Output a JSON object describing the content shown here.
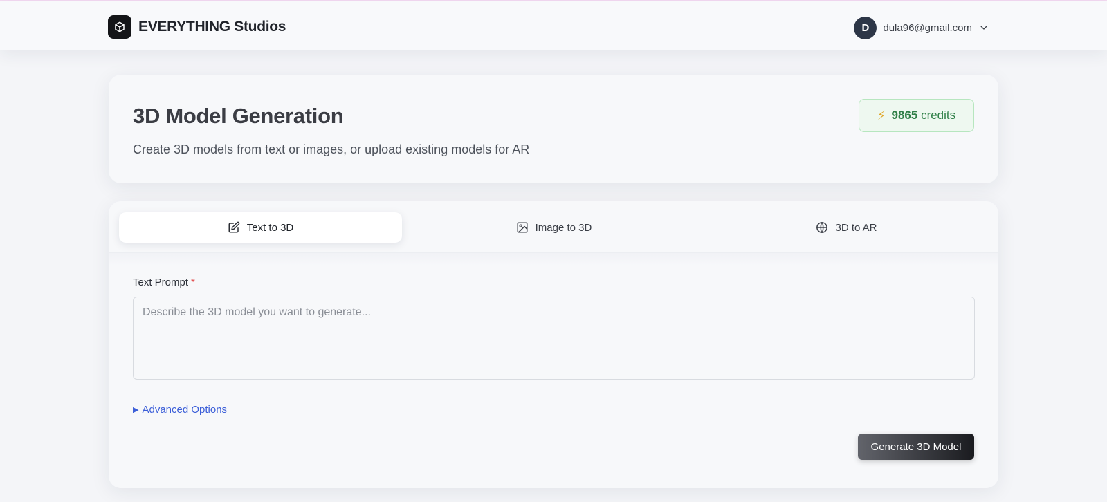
{
  "header": {
    "brand_name": "EVERYTHING Studios",
    "logo_icon": "cube-icon",
    "user": {
      "avatar_initial": "D",
      "email": "dula96@gmail.com",
      "menu_icon": "chevron-down-icon"
    }
  },
  "overview": {
    "title": "3D Model Generation",
    "subtitle": "Create 3D models from text or images, or upload existing models for AR",
    "credits": {
      "icon": "lightning-icon",
      "value": "9865",
      "unit": "credits"
    }
  },
  "tabs": [
    {
      "label": "Text to 3D",
      "icon": "edit-icon",
      "active": true
    },
    {
      "label": "Image to 3D",
      "icon": "image-icon",
      "active": false
    },
    {
      "label": "3D to AR",
      "icon": "globe-icon",
      "active": false
    }
  ],
  "form": {
    "prompt_label": "Text Prompt",
    "required_mark": "*",
    "prompt_value": "",
    "prompt_placeholder": "Describe the 3D model you want to generate...",
    "advanced_caret": "▶",
    "advanced_label": "Advanced Options",
    "submit_label": "Generate 3D Model"
  },
  "colors": {
    "accent_link": "#3b5ed8",
    "credits_text": "#2f7f47",
    "credits_border": "#b7e6bf",
    "required": "#e24a4a"
  }
}
